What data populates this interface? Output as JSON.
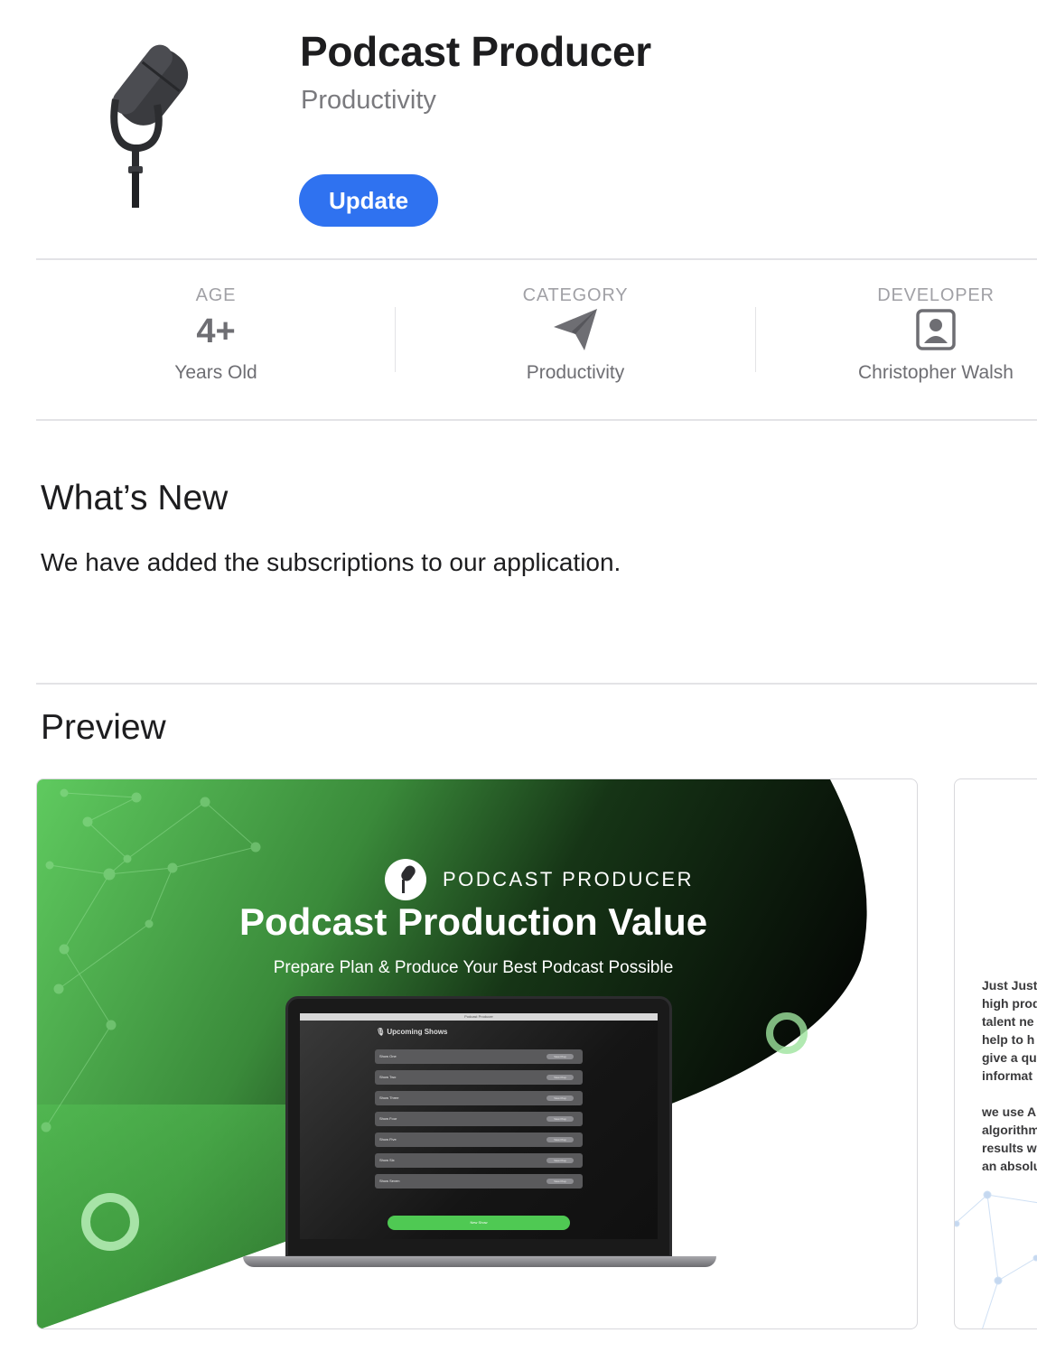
{
  "app": {
    "title": "Podcast Producer",
    "subtitle": "Productivity",
    "update_label": "Update",
    "accent_color": "#2f72f0"
  },
  "info": {
    "age": {
      "label": "AGE",
      "value": "4+",
      "sub": "Years Old"
    },
    "category": {
      "label": "CATEGORY",
      "icon": "paper-plane-icon",
      "sub": "Productivity"
    },
    "developer": {
      "label": "DEVELOPER",
      "icon": "person-icon",
      "sub": "Christopher Walsh"
    }
  },
  "whats_new": {
    "title": "What’s New",
    "body": "We have added the subscriptions to our application."
  },
  "preview": {
    "title": "Preview",
    "screenshot1": {
      "brand": "PODCAST PRODUCER",
      "headline": "Podcast Production Value",
      "tagline": "Prepare Plan & Produce Your Best Podcast Possible",
      "screen_title": "Podcast Producer",
      "screen_heading": "Upcoming Shows",
      "shows": [
        "Show One",
        "Show Two",
        "Show Three",
        "Show Four",
        "Show Five",
        "Show Six",
        "Show Seven"
      ],
      "row_action": "View Prep",
      "new_show": "New Show",
      "green_color": "#5cc95c"
    },
    "screenshot2": {
      "lines": [
        "Just Just",
        "high prod",
        "talent ne",
        "help to h",
        "give a qu",
        "informat",
        "",
        " we use A",
        "algorithm",
        "results w",
        "an absolu"
      ]
    }
  }
}
